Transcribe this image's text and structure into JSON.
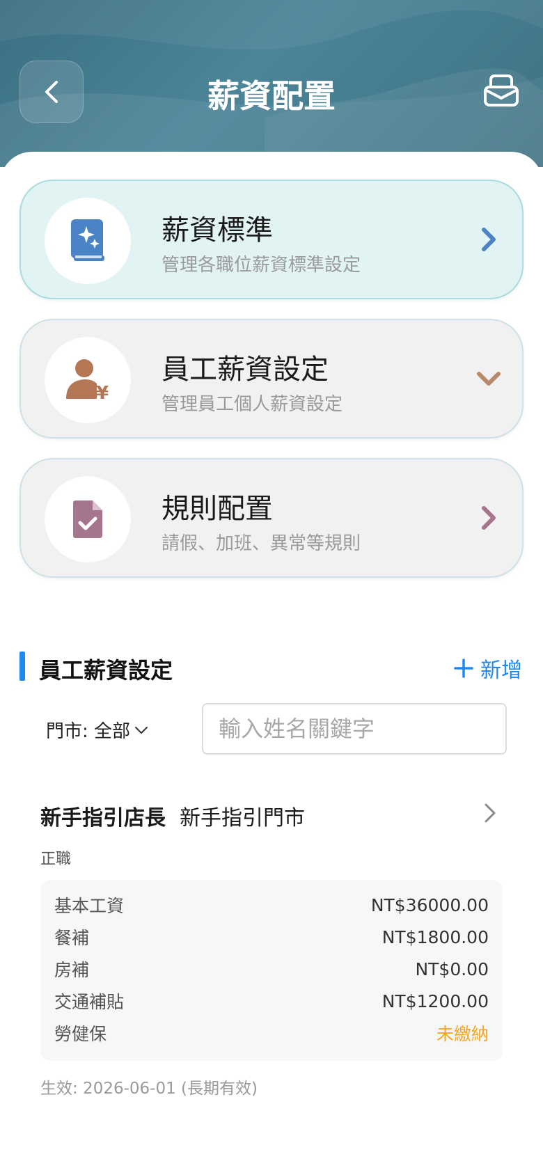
{
  "header": {
    "title": "薪資配置"
  },
  "cards": [
    {
      "title": "薪資標準",
      "subtitle": "管理各職位薪資標準設定",
      "icon": "salary-book-icon",
      "chevron": "chevron-right-icon"
    },
    {
      "title": "員工薪資設定",
      "subtitle": "管理員工個人薪資設定",
      "icon": "person-yen-icon",
      "chevron": "chevron-down-icon"
    },
    {
      "title": "規則配置",
      "subtitle": "請假、加班、異常等規則",
      "icon": "document-check-icon",
      "chevron": "chevron-right-icon"
    }
  ],
  "section": {
    "title": "員工薪資設定",
    "add_label": "新增"
  },
  "filter": {
    "store_label": "門市: 全部",
    "search_placeholder": "輸入姓名關鍵字",
    "search_value": ""
  },
  "employee": {
    "name": "新手指引店長",
    "store": "新手指引門市",
    "type": "正職",
    "salary": [
      {
        "label": "基本工資",
        "value": "NT$36000.00"
      },
      {
        "label": "餐補",
        "value": "NT$1800.00"
      },
      {
        "label": "房補",
        "value": "NT$0.00"
      },
      {
        "label": "交通補貼",
        "value": "NT$1200.00"
      },
      {
        "label": "勞健保",
        "value": "未繳納"
      }
    ],
    "effective": "生效: 2026-06-01 (長期有效)"
  },
  "colors": {
    "accent": "#1e88f0",
    "warning": "#f5a623",
    "header_bg": "#3b6f82",
    "active_card_bg": "#e2f3f3",
    "card_bg": "#f1f1f2"
  }
}
